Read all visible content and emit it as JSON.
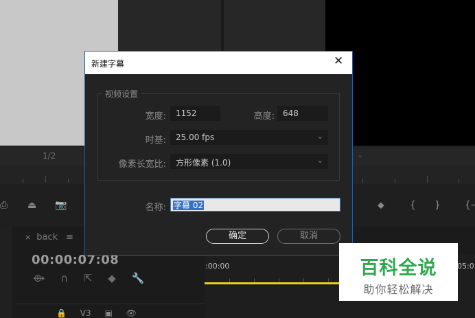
{
  "background": {
    "monitor_zoom": "1/2",
    "sequence_tab": {
      "close": "×",
      "name": "back",
      "menu": "≡"
    },
    "timecode": "00:00:07:08",
    "ruler_start": ":00:00",
    "ruler_end": "05:0",
    "track": {
      "lock": "🔒",
      "name": "V3",
      "sync": "▣",
      "eye": "👁"
    },
    "tools": {
      "export_frame": "⎙",
      "camera": "📷",
      "marker": "⬥",
      "in_bracket": "{",
      "out_bracket": "}",
      "goto": "{⇥"
    },
    "timeline_tools": [
      "⟴",
      "∩",
      "⇱",
      "◆",
      "🔧"
    ]
  },
  "dialog": {
    "title": "新建字幕",
    "close_glyph": "✕",
    "video_settings": {
      "legend": "视频设置",
      "width_label": "宽度:",
      "width_value": "1152",
      "height_label": "高度:",
      "height_value": "648",
      "timebase_label": "时基:",
      "timebase_value": "25.00 fps",
      "par_label": "像素长宽比:",
      "par_value": "方形像素 (1.0)"
    },
    "name_label": "名称:",
    "name_value": "字幕 02",
    "ok_label": "确定",
    "cancel_label": "取消"
  },
  "watermark": {
    "main": "百科全说",
    "sub": "助你轻松解决"
  },
  "colors": {
    "accent_blue": "#3370c6",
    "work_area_yellow": "#e5d21d",
    "watermark_green": "#2fa84f"
  }
}
